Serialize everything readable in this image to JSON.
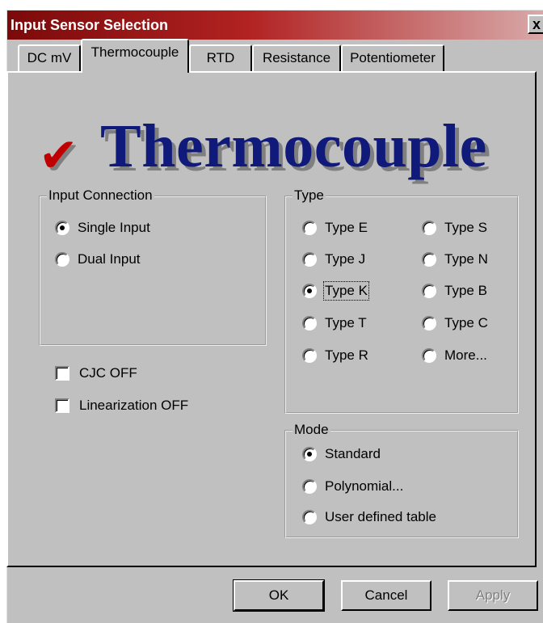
{
  "window": {
    "title": "Input Sensor Selection",
    "close_glyph": "x"
  },
  "tabs": [
    {
      "label": "DC mV"
    },
    {
      "label": "Thermocouple",
      "active": true
    },
    {
      "label": "RTD"
    },
    {
      "label": "Resistance"
    },
    {
      "label": "Potentiometer"
    }
  ],
  "banner": {
    "check_glyph": "✔",
    "title": "Thermocouple",
    "check_color": "#c00000",
    "title_color": "#101a7a"
  },
  "input_connection": {
    "label": "Input Connection",
    "options": [
      {
        "label": "Single Input",
        "selected": true
      },
      {
        "label": "Dual Input",
        "selected": false
      }
    ]
  },
  "checkboxes": [
    {
      "label": "CJC OFF",
      "checked": false
    },
    {
      "label": "Linearization OFF",
      "checked": false
    }
  ],
  "type": {
    "label": "Type",
    "options": [
      {
        "label": "Type E",
        "selected": false
      },
      {
        "label": "Type S",
        "selected": false
      },
      {
        "label": "Type J",
        "selected": false
      },
      {
        "label": "Type N",
        "selected": false
      },
      {
        "label": "Type K",
        "selected": true
      },
      {
        "label": "Type B",
        "selected": false
      },
      {
        "label": "Type T",
        "selected": false
      },
      {
        "label": "Type C",
        "selected": false
      },
      {
        "label": "Type R",
        "selected": false
      },
      {
        "label": "More...",
        "selected": false
      }
    ]
  },
  "mode": {
    "label": "Mode",
    "options": [
      {
        "label": "Standard",
        "selected": true
      },
      {
        "label": "Polynomial...",
        "selected": false
      },
      {
        "label": "User defined table",
        "selected": false
      }
    ]
  },
  "buttons": {
    "ok": "OK",
    "cancel": "Cancel",
    "apply": "Apply"
  },
  "colors": {
    "dialog_bg": "#c0c0c0",
    "titlebar_start": "#7b0a0a",
    "titlebar_end": "#d8a9a9"
  }
}
